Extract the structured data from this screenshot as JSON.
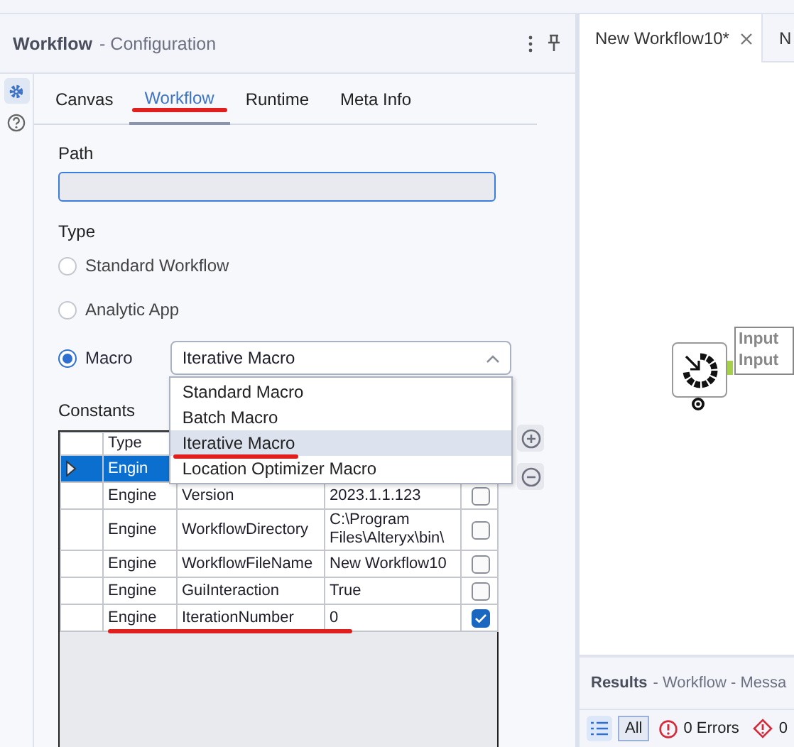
{
  "panel": {
    "title": "Workflow",
    "subtitle": "- Configuration"
  },
  "tabs": [
    {
      "label": "Canvas",
      "selected": false,
      "underlined": false
    },
    {
      "label": "Workflow",
      "selected": true,
      "underlined": true
    },
    {
      "label": "Runtime",
      "selected": false,
      "underlined": false
    },
    {
      "label": "Meta Info",
      "selected": false,
      "underlined": false
    }
  ],
  "path": {
    "label": "Path"
  },
  "type": {
    "label": "Type",
    "options": [
      {
        "label": "Standard Workflow",
        "selected": false
      },
      {
        "label": "Analytic App",
        "selected": false
      },
      {
        "label": "Macro",
        "selected": true
      }
    ]
  },
  "macro_select": {
    "value": "Iterative Macro",
    "expanded": true,
    "options": [
      {
        "label": "Standard Macro",
        "selected": false,
        "underlined": false
      },
      {
        "label": "Batch Macro",
        "selected": false,
        "underlined": false
      },
      {
        "label": "Iterative Macro",
        "selected": true,
        "underlined": true
      },
      {
        "label": "Location Optimizer Macro",
        "selected": false,
        "underlined": false
      }
    ]
  },
  "constants": {
    "label": "Constants",
    "columns": [
      "Type"
    ],
    "rows": [
      {
        "type": "Engin",
        "selected": true,
        "underlined": false
      },
      {
        "type": "Engine",
        "name": "Version",
        "value": "2023.1.1.123",
        "checked": false,
        "selected": false,
        "underlined": false
      },
      {
        "type": "Engine",
        "name": "WorkflowDirectory",
        "value": "C:\\Program Files\\Alteryx\\bin\\",
        "checked": false,
        "selected": false,
        "underlined": false
      },
      {
        "type": "Engine",
        "name": "WorkflowFileName",
        "value": "New Workflow10",
        "checked": false,
        "selected": false,
        "underlined": false
      },
      {
        "type": "Engine",
        "name": "GuiInteraction",
        "value": "True",
        "checked": false,
        "selected": false,
        "underlined": false
      },
      {
        "type": "Engine",
        "name": "IterationNumber",
        "value": "0",
        "checked": true,
        "selected": false,
        "underlined": true
      }
    ]
  },
  "canvas": {
    "tabs": [
      {
        "label": "New Workflow10*",
        "selected": true
      },
      {
        "label": "N",
        "selected": false
      }
    ],
    "node": {
      "label_lines": [
        "Input",
        "Input"
      ]
    }
  },
  "results": {
    "title": "Results",
    "subtitle": "- Workflow - Messa",
    "filters": [
      {
        "kind": "all",
        "label": "All",
        "selected": true
      },
      {
        "kind": "errors",
        "label": "0 Errors",
        "selected": false
      },
      {
        "kind": "conversion",
        "label": "0",
        "selected": false
      }
    ]
  }
}
